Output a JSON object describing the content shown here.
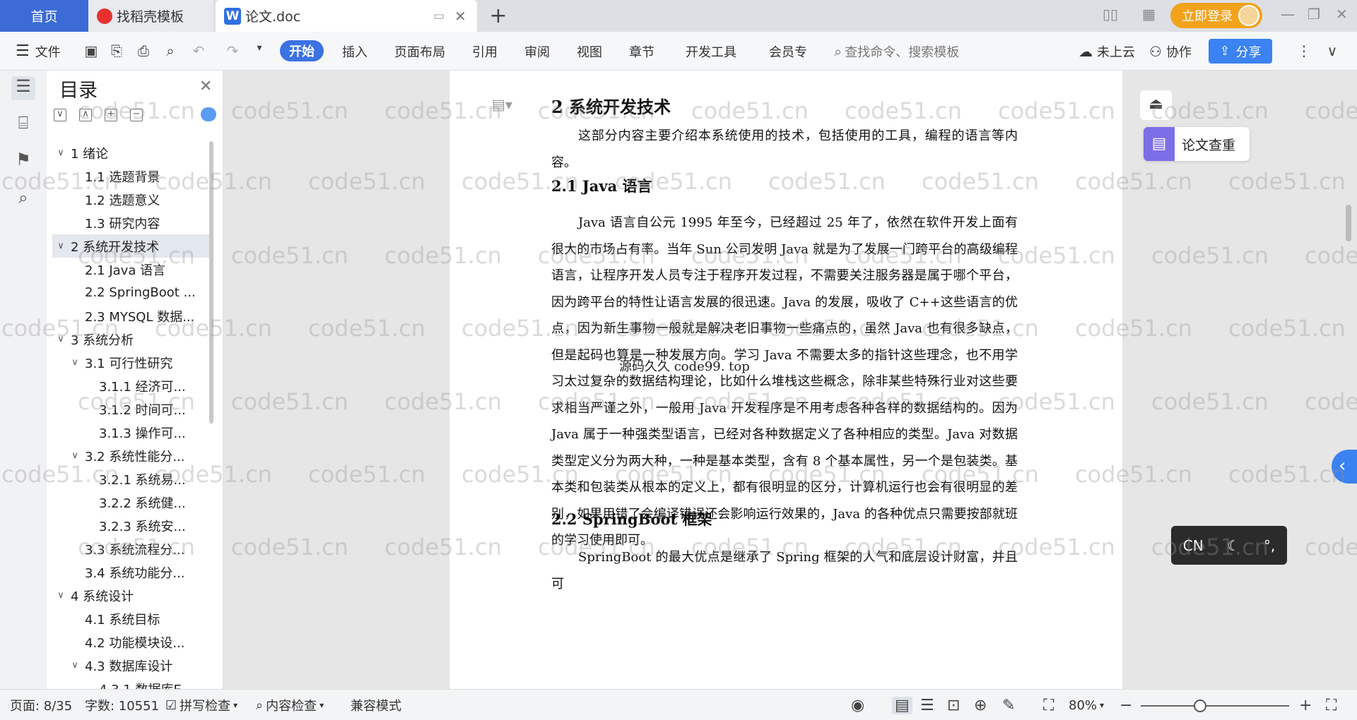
{
  "tabs": {
    "home": "首页",
    "template": "找稻壳模板",
    "doc": "论文.doc",
    "plus": "+"
  },
  "header": {
    "login": "立即登录",
    "minimize": "—",
    "restore": "❐",
    "close": "✕"
  },
  "toolbar": {
    "file": "文件",
    "menus": [
      "开始",
      "插入",
      "页面布局",
      "引用",
      "审阅",
      "视图",
      "章节",
      "开发工具",
      "会员专"
    ],
    "search_placeholder": "查找命令、搜索模板",
    "cloud": "未上云",
    "collab": "协作",
    "share": "分享"
  },
  "toc": {
    "title": "目录",
    "items": [
      {
        "label": "1  绪论",
        "level": 0,
        "caret": "∨"
      },
      {
        "label": "1.1  选题背景",
        "level": 1,
        "caret": ""
      },
      {
        "label": "1.2  选题意义",
        "level": 1,
        "caret": ""
      },
      {
        "label": "1.3  研究内容",
        "level": 1,
        "caret": ""
      },
      {
        "label": "2  系统开发技术",
        "level": 0,
        "caret": "∨",
        "active": true
      },
      {
        "label": "2.1 Java 语言",
        "level": 1,
        "caret": ""
      },
      {
        "label": "2.2 SpringBoot ...",
        "level": 1,
        "caret": ""
      },
      {
        "label": "2.3 MYSQL 数据...",
        "level": 1,
        "caret": ""
      },
      {
        "label": "3  系统分析",
        "level": 0,
        "caret": "∨"
      },
      {
        "label": "3.1 可行性研究",
        "level": 1,
        "caret": "∨"
      },
      {
        "label": "3.1.1 经济可...",
        "level": 2,
        "caret": ""
      },
      {
        "label": "3.1.2 时间可...",
        "level": 2,
        "caret": ""
      },
      {
        "label": "3.1.3 操作可...",
        "level": 2,
        "caret": ""
      },
      {
        "label": "3.2 系统性能分...",
        "level": 1,
        "caret": "∨"
      },
      {
        "label": "3.2.1 系统易...",
        "level": 2,
        "caret": ""
      },
      {
        "label": "3.2.2 系统健...",
        "level": 2,
        "caret": ""
      },
      {
        "label": "3.2.3 系统安...",
        "level": 2,
        "caret": ""
      },
      {
        "label": "3.3  系统流程分...",
        "level": 1,
        "caret": ""
      },
      {
        "label": "3.4 系统功能分...",
        "level": 1,
        "caret": ""
      },
      {
        "label": "4  系统设计",
        "level": 0,
        "caret": "∨"
      },
      {
        "label": "4.1 系统目标",
        "level": 1,
        "caret": ""
      },
      {
        "label": "4.2 功能模块设...",
        "level": 1,
        "caret": ""
      },
      {
        "label": "4.3 数据库设计",
        "level": 1,
        "caret": "∨"
      },
      {
        "label": "4.3.1 数据库E...",
        "level": 2,
        "caret": ""
      }
    ]
  },
  "document": {
    "heading": "2  系统开发技术",
    "intro": "这部分内容主要介绍本系统使用的技术，包括使用的工具，编程的语言等内容。",
    "sec1_title": "2.1 Java 语言",
    "sec1_body": "Java 语言自公元 1995 年至今，已经超过 25 年了，依然在软件开发上面有很大的市场占有率。当年 Sun 公司发明 Java 就是为了发展一门跨平台的高级编程语言，让程序开发人员专注于程序开发过程，不需要关注服务器是属于哪个平台，因为跨平台的特性让语言发展的很迅速。Java 的发展，吸收了 C++这些语言的优点，因为新生事物一般就是解决老旧事物一些痛点的，虽然 Java 也有很多缺点，但是起码也算是一种发展方向。学习 Java 不需要太多的指针这些理念，也不用学习太过复杂的数据结构理论，比如什么堆栈这些概念，除非某些特殊行业对这些要求相当严谨之外，一般用 Java 开发程序是不用考虑各种各样的数据结构的。因为 Java 属于一种强类型语言，已经对各种数据定义了各种相应的类型。Java 对数据类型定义分为两大种，一种是基本类型，含有 8 个基本属性，另一个是包装类。基本类和包装类从根本的定义上，都有很明显的区分，计算机运行也会有很明显的差别，如果用错了会编译错误还会影响运行效果的，Java 的各种优点只需要按部就班的学习使用即可。",
    "sec2_title": "2.2 SpringBoot 框架",
    "sec2_body": "SpringBoot 的最大优点是继承了 Spring 框架的人气和底层设计财富，并且可",
    "overlay": "源码久久 code99. top"
  },
  "right": {
    "chachong": "论文查重",
    "ime_cn": "CN",
    "ime_moon": "☾",
    "ime_punct": "°,"
  },
  "watermark": "code51.cn",
  "status": {
    "page": "页面: 8/35",
    "words": "字数: 10551",
    "spell": "拼写检查",
    "content": "内容检查",
    "mode": "兼容模式",
    "zoom": "80%",
    "zoom_level": 0.4
  }
}
